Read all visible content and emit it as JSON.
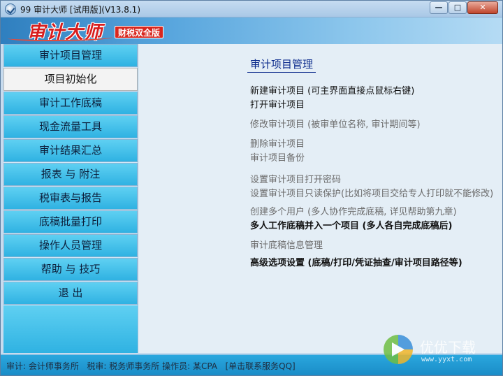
{
  "window": {
    "title": "99  审计大师 [试用版](V13.8.1)",
    "controls": {
      "minimize": "—",
      "maximize": "□",
      "close": "✕"
    }
  },
  "banner": {
    "logo": "审计大师",
    "edition": "财税双全版"
  },
  "sidebar": {
    "items": [
      {
        "label": "审计项目管理",
        "active": false
      },
      {
        "label": "项目初始化",
        "active": true
      },
      {
        "label": "审计工作底稿",
        "active": false
      },
      {
        "label": "现金流量工具",
        "active": false
      },
      {
        "label": "审计结果汇总",
        "active": false
      },
      {
        "label": "报表 与 附注",
        "active": false
      },
      {
        "label": "税审表与报告",
        "active": false
      },
      {
        "label": "底稿批量打印",
        "active": false
      },
      {
        "label": "操作人员管理",
        "active": false
      },
      {
        "label": "帮助 与 技巧",
        "active": false
      },
      {
        "label": "退    出",
        "active": false
      }
    ]
  },
  "main": {
    "title": "审计项目管理",
    "links": [
      {
        "label": "新建审计项目 (可主界面直接点鼠标右键)",
        "style": "primary"
      },
      {
        "label": "打开审计项目",
        "style": "primary"
      },
      {
        "label": "修改审计项目 (被审单位名称, 审计期间等)",
        "style": "secondary"
      },
      {
        "label": "删除审计项目",
        "style": "secondary"
      },
      {
        "label": "审计项目备份",
        "style": "secondary"
      },
      {
        "label": "设置审计项目打开密码",
        "style": "secondary"
      },
      {
        "label": "设置审计项目只读保护(比如将项目交给专人打印就不能修改)",
        "style": "secondary"
      },
      {
        "label": "创建多个用户 (多人协作完成底稿, 详见帮助第九章)",
        "style": "secondary"
      },
      {
        "label": "多人工作底稿并入一个项目 (多人各自完成底稿后)",
        "style": "bold"
      },
      {
        "label": "审计底稿信息管理",
        "style": "secondary"
      },
      {
        "label": "高级选项设置 (底稿/打印/凭证抽查/审计项目路径等)",
        "style": "bold"
      }
    ]
  },
  "statusbar": {
    "audit_label": "审计:",
    "audit_value": "会计师事务所",
    "tax_label": "税审:",
    "tax_value": "税务师事务所",
    "operator_label": "操作员:",
    "operator_value": "某CPA",
    "contact_link": "[单击联系服务QQ]"
  },
  "watermark": {
    "name": "优优下载",
    "url": "www.yyxt.com"
  }
}
